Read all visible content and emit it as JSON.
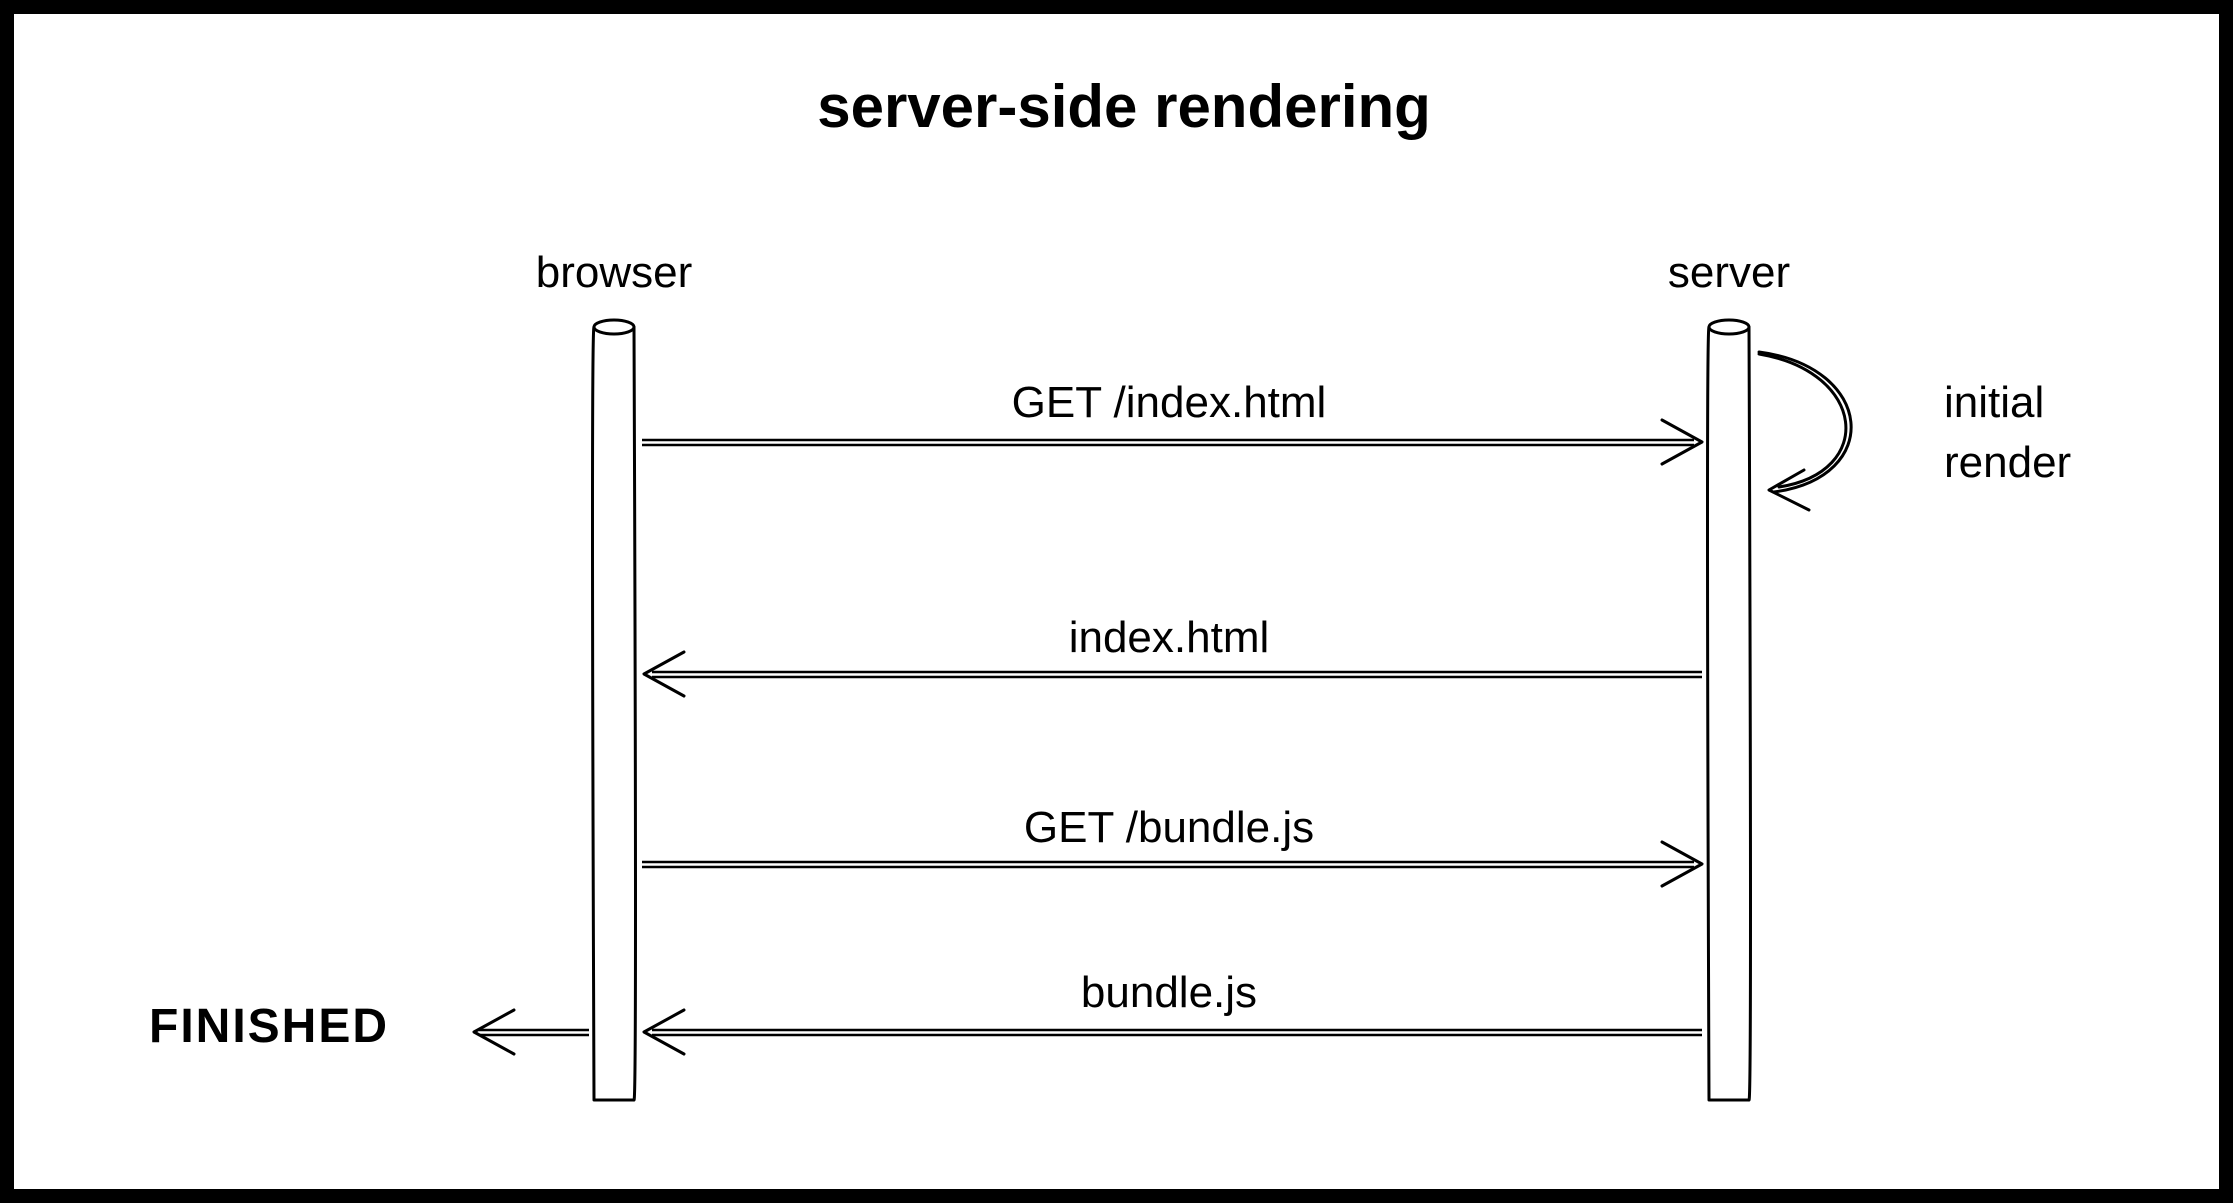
{
  "title": "server-side rendering",
  "participants": {
    "browser": "browser",
    "server": "server"
  },
  "messages": [
    {
      "id": "get-index",
      "label": "GET /index.html",
      "from": "browser",
      "to": "server"
    },
    {
      "id": "resp-index",
      "label": "index.html",
      "from": "server",
      "to": "browser"
    },
    {
      "id": "get-bundle",
      "label": "GET /bundle.js",
      "from": "browser",
      "to": "server"
    },
    {
      "id": "resp-bundle",
      "label": "bundle.js",
      "from": "server",
      "to": "browser"
    }
  ],
  "annotations": {
    "initial_render_line1": "initial",
    "initial_render_line2": "render",
    "finished": "FINISHED"
  }
}
